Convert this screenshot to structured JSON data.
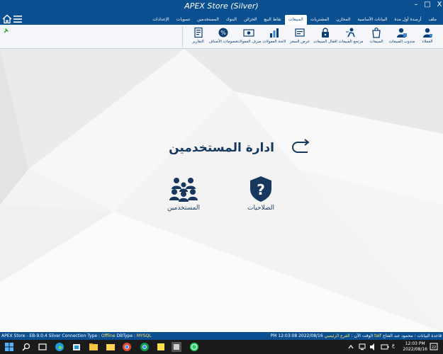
{
  "window": {
    "title": "APEX Store (Silver)",
    "controls": {
      "close": "X",
      "maximize": "□",
      "minimize": "–"
    }
  },
  "menu": {
    "items": [
      {
        "label": "ملف",
        "active": false
      },
      {
        "label": "أرصدة أول مدة",
        "active": false
      },
      {
        "label": "البيانات الأساسية",
        "active": false
      },
      {
        "label": "المخازن",
        "active": false
      },
      {
        "label": "المشتريات",
        "active": false
      },
      {
        "label": "المبيعات",
        "active": true
      },
      {
        "label": "نقاط البيع",
        "active": false
      },
      {
        "label": "الخزائن",
        "active": false
      },
      {
        "label": "البنوك",
        "active": false
      },
      {
        "label": "المستخدمين",
        "active": false
      },
      {
        "label": "تسويات",
        "active": false
      },
      {
        "label": "الإعدادات",
        "active": false
      }
    ]
  },
  "ribbon": {
    "items": [
      {
        "label": "العملاء",
        "icon": "customer-icon"
      },
      {
        "label": "مندوب المبيعات",
        "icon": "sales-rep-icon"
      },
      {
        "label": "المبيعات",
        "icon": "shopping-bag-icon"
      },
      {
        "label": "مرتجع المبيعات",
        "icon": "sales-return-icon"
      },
      {
        "label": "اقفال المبيعات",
        "icon": "lock-icon"
      },
      {
        "label": "عرض السعر",
        "icon": "price-quote-icon"
      },
      {
        "label": "لائحة العمولات",
        "icon": "commission-chart-icon"
      },
      {
        "label": "صرف العمولات",
        "icon": "cash-icon"
      },
      {
        "label": "خصومات الأصناف",
        "icon": "discount-icon"
      },
      {
        "label": "التقارير",
        "icon": "report-icon"
      }
    ]
  },
  "main": {
    "title": "ادارة المستخدمين",
    "tiles": [
      {
        "label": "الصلاحيات",
        "icon": "shield-question-icon"
      },
      {
        "label": "المستخدمين",
        "icon": "users-group-icon"
      }
    ]
  },
  "status": {
    "app": "APEX Store - EB-9.0.4 Silver",
    "connection_label": "Connection Type :",
    "connection_value": "Offline",
    "dbtype_label": "DBType :",
    "dbtype_value": "MYSQL",
    "time_value": "PM 12:03:08 2022/08/16",
    "time_label": "الوقت الآن :",
    "branch_value": "الفرع الرئيسي",
    "db_label": "قاعدة البيانات :",
    "db_value": "taif",
    "user_value": "محمود عبد الفتاح"
  },
  "taskbar": {
    "time": "12:03 PM",
    "date": "2022/08/16",
    "lang": "ع",
    "notify_count": "22"
  },
  "colors": {
    "primary": "#0a4f8f",
    "accent_text": "#16385f",
    "highlight": "#ffe36a"
  }
}
